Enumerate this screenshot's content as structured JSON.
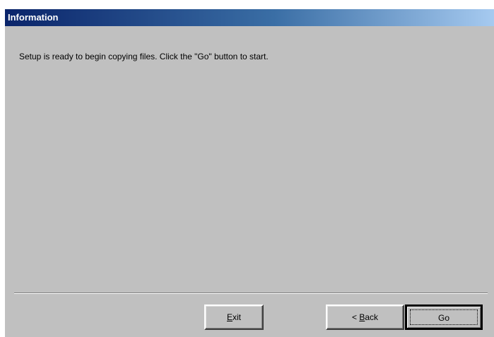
{
  "window": {
    "title": "Information"
  },
  "message": "Setup is ready to begin copying files. Click the \"Go\" button to start.",
  "buttons": {
    "exit": {
      "prefix": "",
      "accel": "E",
      "rest": "xit"
    },
    "back": {
      "prefix": "< ",
      "accel": "B",
      "rest": "ack"
    },
    "go": {
      "label": "Go"
    }
  },
  "colors": {
    "titlebar_start": "#0a246a",
    "titlebar_end": "#a6caf0",
    "dialog_face": "#c0c0c0"
  }
}
